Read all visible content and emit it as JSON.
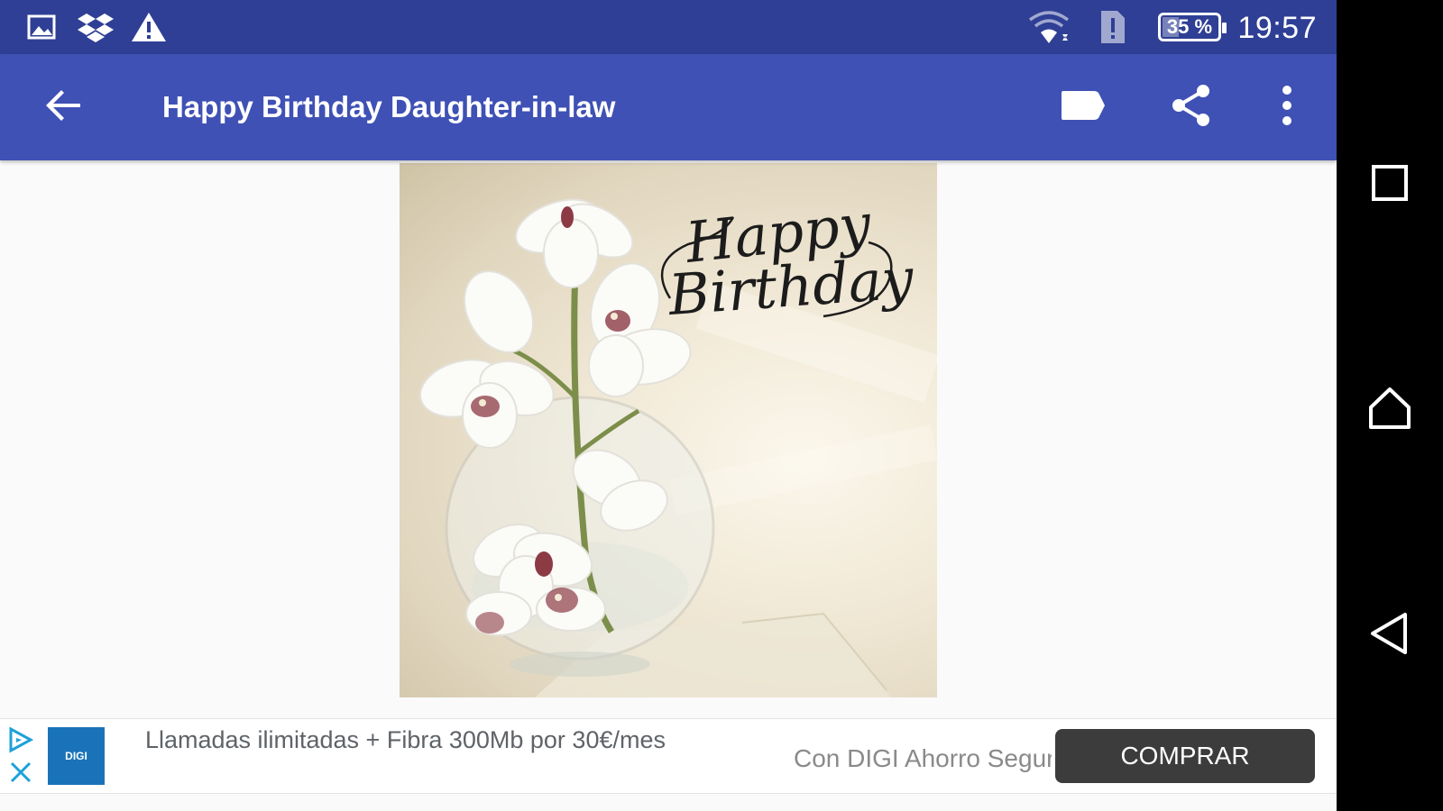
{
  "status_bar": {
    "time": "19:57",
    "battery_text": "35 %",
    "battery_level": 0.35,
    "icons": [
      "image-icon",
      "dropbox-icon",
      "warning-icon",
      "wifi-icon",
      "sim-alert-icon",
      "battery-icon"
    ]
  },
  "app_bar": {
    "title": "Happy Birthday Daughter-in-law",
    "back_icon": "arrow-back-icon",
    "actions": [
      "label-icon",
      "share-icon",
      "more-vert-icon"
    ]
  },
  "card": {
    "greeting_line1": "Happy",
    "greeting_line2": "Birthday"
  },
  "ad": {
    "logo_text": "DIGI",
    "headline": "Llamadas ilimitadas + Fibra 300Mb por 30€/mes",
    "subtext": "Con DIGI Ahorro Seguro",
    "cta": "COMPRAR"
  },
  "nav_bar": {
    "icons": [
      "recents-square-icon",
      "home-icon",
      "back-triangle-icon"
    ]
  },
  "colors": {
    "status_bar": "#2f3f95",
    "app_bar": "#3f51b5",
    "cta_button": "#3c3c3c"
  }
}
